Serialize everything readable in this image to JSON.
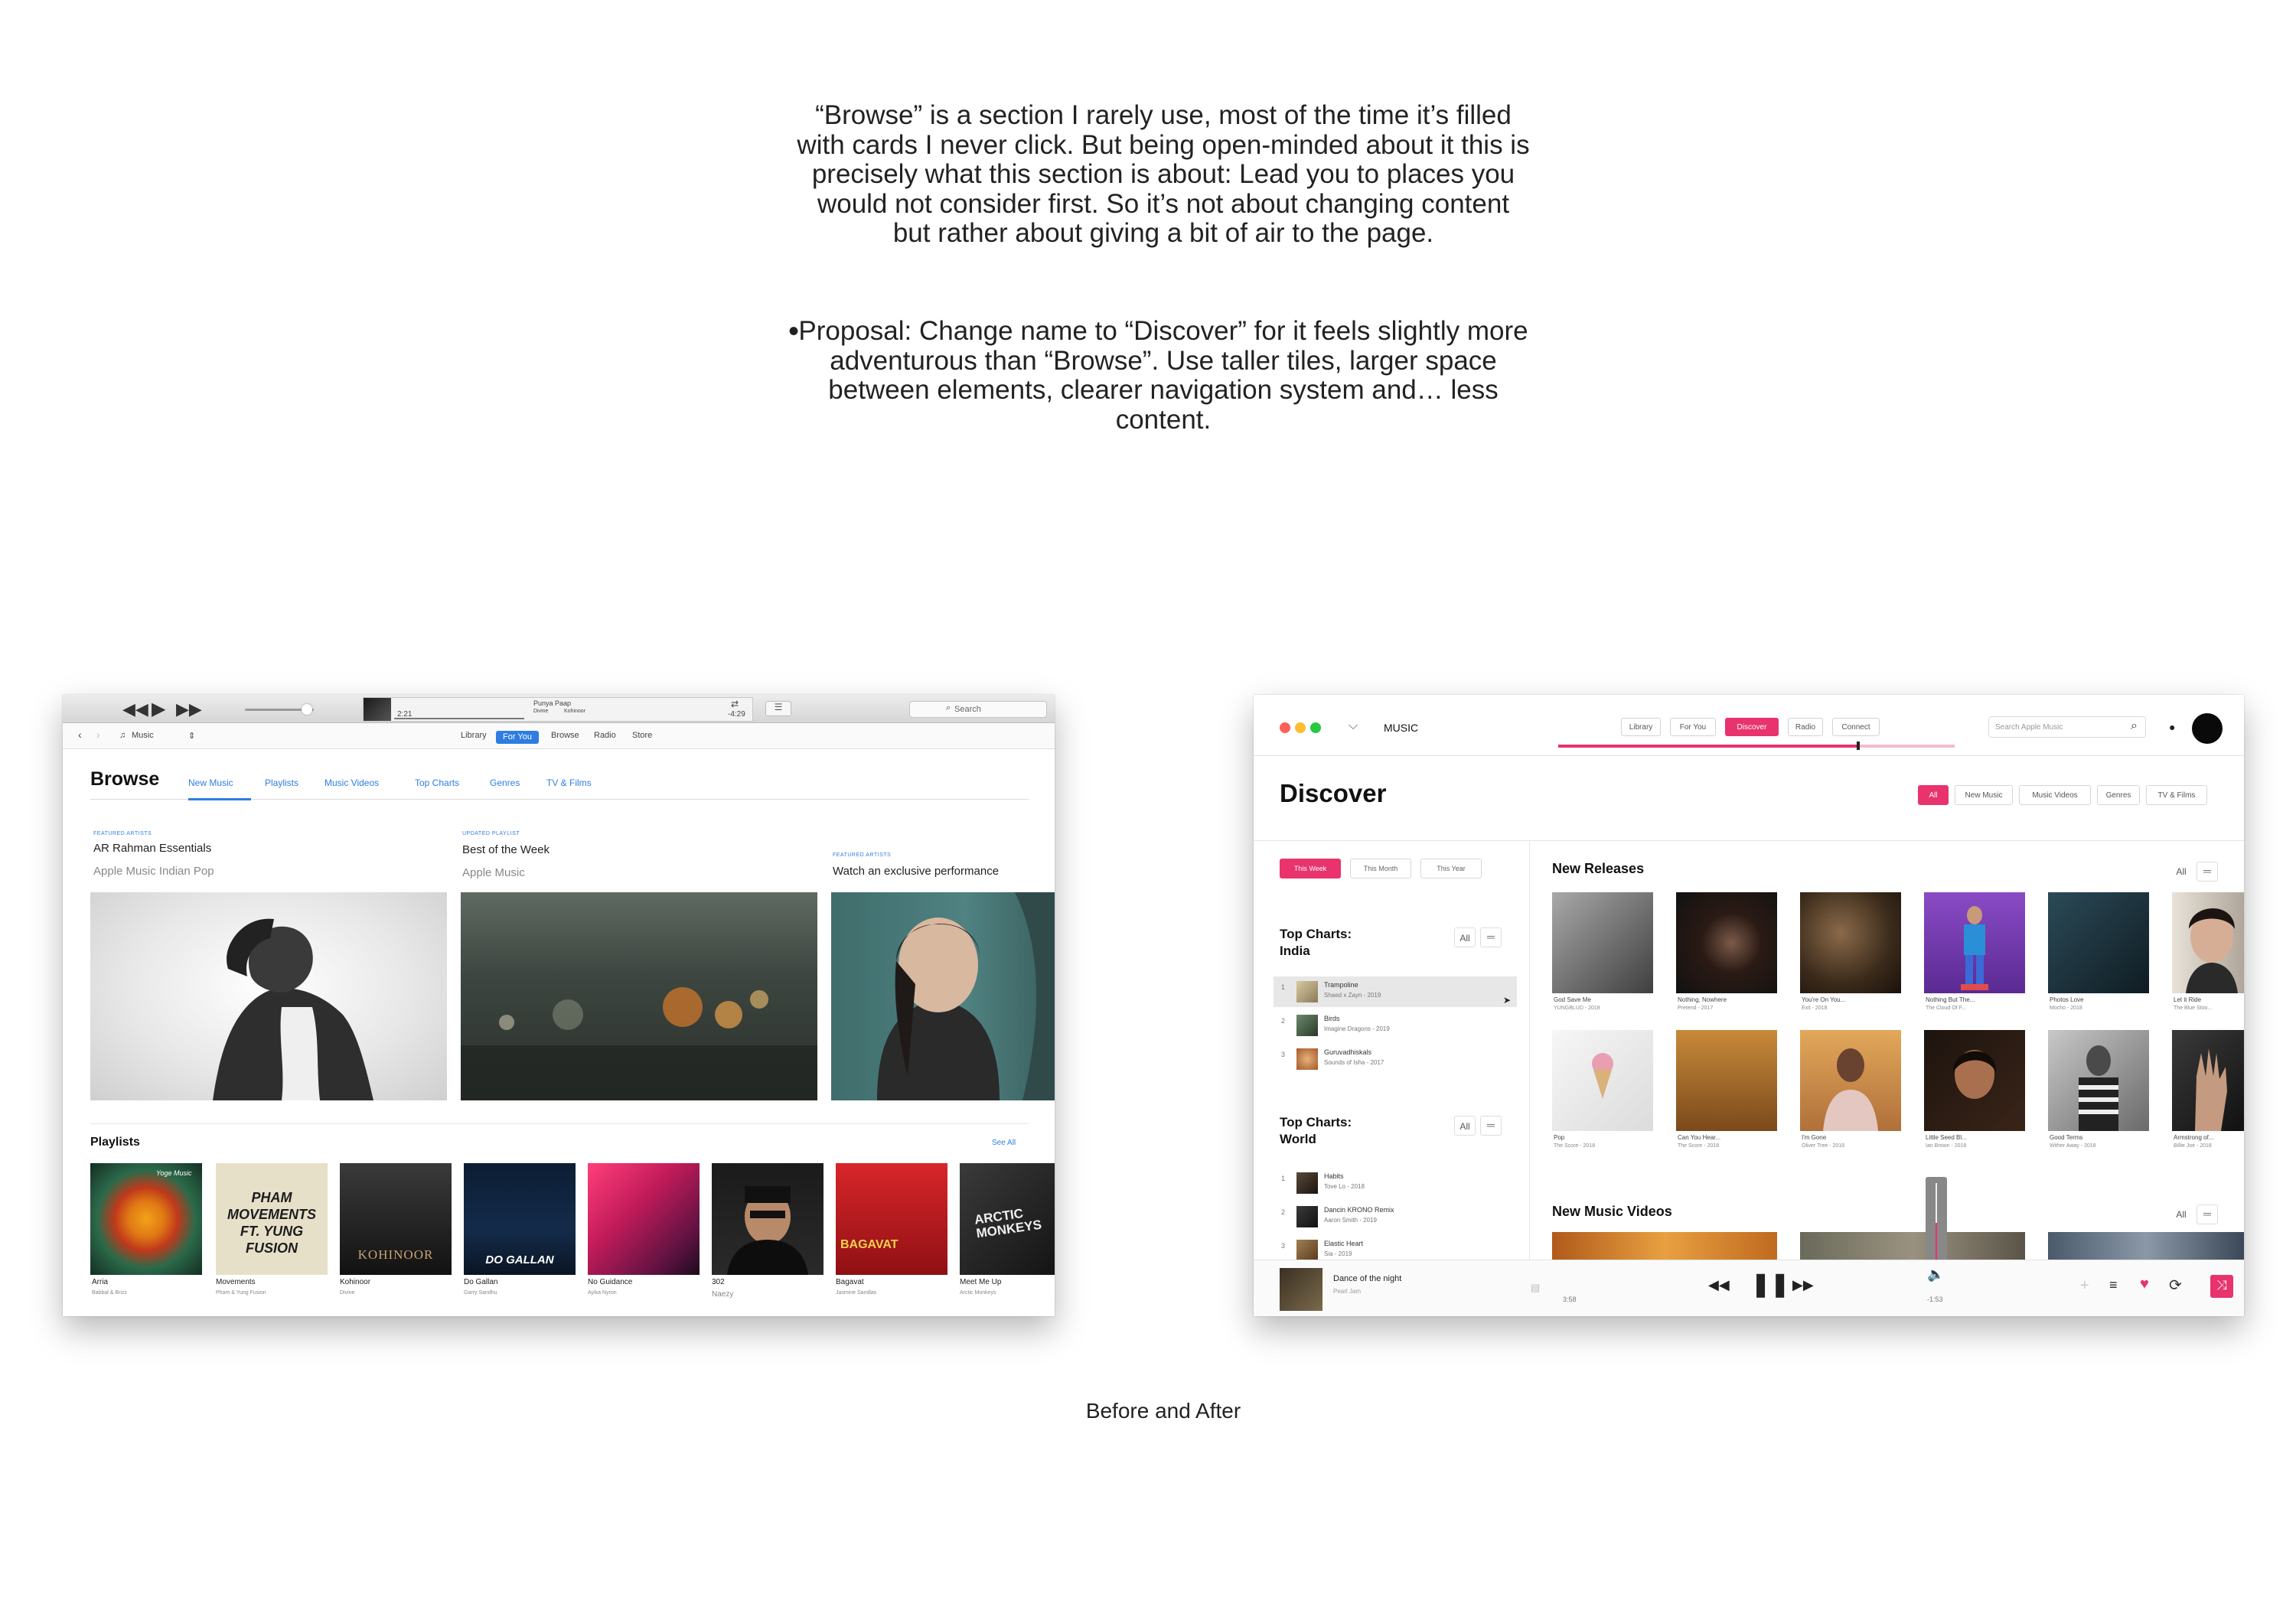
{
  "intro": "“Browse” is a section I rarely use, most of the time it’s filled with cards I never click. But being open-minded about it this is precisely what this section is about: Lead you to places you would not consider first. So it’s not about changing content but rather about giving a bit of air to the page.",
  "proposal": "Proposal: Change name to “Discover” for it feels slightly more adventurous than “Browse”. Use taller tiles, larger space between elements, clearer navigation system and… less content.",
  "caption": "Before and After",
  "before": {
    "lcd": {
      "time_elapsed": "2:21",
      "time_remaining": "-4:29",
      "song": "Punya Paap",
      "artist": "Divine",
      "album": "Kohinoor"
    },
    "search": "Search",
    "location": "Music",
    "nav": [
      "Library",
      "For You",
      "Browse",
      "Radio",
      "Store"
    ],
    "title": "Browse",
    "tabs": [
      "New Music",
      "Playlists",
      "Music Videos",
      "Top Charts",
      "Genres",
      "TV & Films"
    ],
    "featured": [
      {
        "kicker": "FEATURED ARTISTS",
        "title": "AR Rahman Essentials",
        "subtitle": "Apple Music Indian Pop"
      },
      {
        "kicker": "UPDATED PLAYLIST",
        "title": "Best of the Week",
        "subtitle": "Apple Music"
      },
      {
        "kicker": "FEATURED ARTISTS",
        "title": "Watch an exclusive performance",
        "subtitle": ""
      }
    ],
    "playlists_title": "Playlists",
    "see_all": "See All",
    "playlists": [
      {
        "name": "Arria",
        "sub": "Babbal & Brizz",
        "art_text": "Yoge Music"
      },
      {
        "name": "Movements",
        "sub": "Pham & Yung Fusion",
        "art_text": "PHAM MOVEMENTS FT. YUNG FUSION"
      },
      {
        "name": "Kohinoor",
        "sub": "Divine",
        "art_text": "KOHINOOR"
      },
      {
        "name": "Do Gallan",
        "sub": "Garry Sandhu",
        "art_text": "DO GALLAN"
      },
      {
        "name": "No Guidance",
        "sub": "Ayika Nyron",
        "art_text": ""
      },
      {
        "name": "302",
        "sub": "Naezy",
        "art_text": ""
      },
      {
        "name": "Bagavat",
        "sub": "Jasmine Sandlas",
        "art_text": "BAGAVAT"
      },
      {
        "name": "Meet Me Up",
        "sub": "Arctic Monkeys",
        "art_text": "ARCTIC MONKEYS"
      }
    ]
  },
  "after": {
    "app_name": "MUSIC",
    "nav": [
      "Library",
      "For You",
      "Discover",
      "Radio",
      "Connect"
    ],
    "search_placeholder": "Search Apple Music",
    "title": "Discover",
    "filters": [
      "All",
      "New Music",
      "Music Videos",
      "Genres",
      "TV & Films"
    ],
    "ranges": [
      "This Week",
      "This Month",
      "This Year"
    ],
    "charts_india_title": "Top Charts: India",
    "charts_world_title": "Top Charts: World",
    "all_label": "All",
    "menu_label": "═",
    "india": [
      {
        "rank": "1",
        "title": "Trampoline",
        "sub": "Shaed x Zayn - 2019"
      },
      {
        "rank": "2",
        "title": "Birds",
        "sub": "Imagine Dragons - 2019"
      },
      {
        "rank": "3",
        "title": "Guruvadhiskals",
        "sub": "Sounds of Isha - 2017"
      }
    ],
    "world": [
      {
        "rank": "1",
        "title": "Habits",
        "sub": "Tove Lo - 2018"
      },
      {
        "rank": "2",
        "title": "Dancin KRONO Remix",
        "sub": "Aaron Smith - 2019"
      },
      {
        "rank": "3",
        "title": "Elastic Heart",
        "sub": "Sia - 2019"
      }
    ],
    "new_releases_title": "New Releases",
    "new_releases": [
      {
        "name": "God Save Me",
        "sub": "YUNGBLUD - 2018"
      },
      {
        "name": "Nothing, Nowhere",
        "sub": "Pretend - 2017"
      },
      {
        "name": "You're On You...",
        "sub": "Exit - 2018"
      },
      {
        "name": "Nothing But The...",
        "sub": "The Cloud Of F..."
      },
      {
        "name": "Photos Love",
        "sub": "Mocho - 2018"
      },
      {
        "name": "Let it Ride",
        "sub": "The Blue Stoo..."
      },
      {
        "name": "Pop",
        "sub": "The Score - 2018"
      },
      {
        "name": "Can You Hear...",
        "sub": "The Score - 2018"
      },
      {
        "name": "I'm Gone",
        "sub": "Oliver Tree - 2018"
      },
      {
        "name": "Little Seed Bl...",
        "sub": "Ian Brown - 2018"
      },
      {
        "name": "Good Terms",
        "sub": "Wither Away - 2018"
      },
      {
        "name": "Armstrong of...",
        "sub": "Billie Joe - 2018"
      }
    ],
    "music_videos_title": "New Music Videos",
    "player": {
      "title": "Dance of the night",
      "artist": "Pearl Jam",
      "elapsed": "3:58",
      "remaining": "-1:53",
      "progress": 0.753,
      "volume": 0.5
    }
  }
}
